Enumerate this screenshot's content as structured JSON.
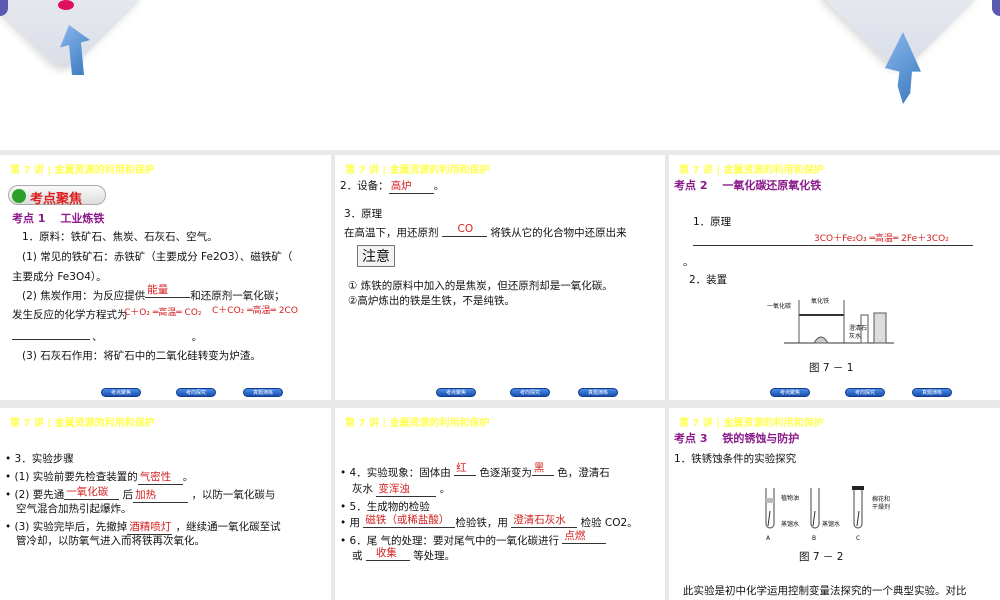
{
  "header": "第 7 讲 | 金属资源的利用和保护",
  "nav": [
    "考点聚焦",
    "考向探究",
    "真题演练"
  ],
  "slide1": {
    "badge": "考点聚焦",
    "kp": "考点 1　 工业炼铁",
    "l1": "1．原料：铁矿石、焦炭、石灰石、空气。",
    "l2": "(1) 常见的铁矿石：赤铁矿（主要成分 Fe2O3）、磁铁矿（",
    "l3": "主要成分 Fe3O4）。",
    "l4a": "(2) 焦炭作用：为反应提供",
    "a1": "能量",
    "l4b": "和还原剂一氧化碳；",
    "l5": "发生反应的化学方程式为",
    "eq1": "C＋O₂ ═高温═ CO₂",
    "eq2": "C＋CO₂ ═高温═ 2CO",
    "l6": "、　　　　　　　　　。",
    "l7": "(3) 石灰石作用：将矿石中的二氧化硅转变为炉渣。"
  },
  "slide2": {
    "l1a": "2．设备：",
    "a1": "高炉",
    "l1b": "。",
    "l2": "3．原理",
    "l3a": "在高温下，用还原剂",
    "a2": "CO",
    "l3b": "将铁从它的化合物中还原出来",
    "note": "注意",
    "n1": "① 炼铁的原料中加入的是焦炭，但还原剂却是一氧化碳。",
    "n2": "②高炉炼出的铁是生铁，不是纯铁。"
  },
  "slide3": {
    "kp": "考点 2　 一氧化碳还原氧化铁",
    "l1": "1．原理",
    "eq": "3CO＋Fe₂O₃ ═高温═ 2Fe＋3CO₂",
    "dot": "。",
    "l2": "2．装置",
    "fig_labels": [
      "一氧化碳",
      "氧化铁",
      "澄清石灰水"
    ],
    "caption": "图 7 － 1"
  },
  "slide4": {
    "l1": "3．实验步骤",
    "l2a": "(1) 实验前要先检查装置的",
    "a1": "气密性",
    "l2b": "。",
    "l3a": "(2) 要先通",
    "a2": "一氧化碳",
    "l3b": "后",
    "a3": "加热",
    "l3c": "，以防一氧化碳与",
    "l3d": "空气混合加热引起爆炸。",
    "l4a": "(3) 实验完毕后，先撤掉",
    "a4": "酒精喷灯",
    "l4b": "，继续通一氧化碳至试",
    "l4c": "管冷却，以防氧气进入而将铁再次氧化。"
  },
  "slide5": {
    "l1a": "4．实验现象：固体由",
    "a1": "红",
    "l1b": "色逐渐变为",
    "a2": "黑",
    "l1c": "色，澄清石",
    "l2a": "灰水",
    "a3": "变浑浊",
    "l2b": "。",
    "l3": "5．生成物的检验",
    "l4a": "用",
    "a4": "磁铁（或稀盐酸）",
    "l4b": "检验铁，用",
    "a5": "澄清石灰水",
    "l4c": "检验 CO2。",
    "l5a": "6．尾 气的处理：要对尾气中的一氧化碳进行",
    "a6": "点燃",
    "l6a": "或",
    "a7": "收集",
    "l6b": "等处理。"
  },
  "slide6": {
    "kp": "考点 3　 铁的锈蚀与防护",
    "l1": "1．铁锈蚀条件的实验探究",
    "fig_labels": [
      "植物油",
      "蒸馏水",
      "蒸馏水",
      "棉花和",
      "干燥剂",
      "A",
      "B",
      "C"
    ],
    "caption": "图 7 － 2",
    "l2": "此实验是初中化学运用控制变量法探究的一个典型实验。对比"
  }
}
